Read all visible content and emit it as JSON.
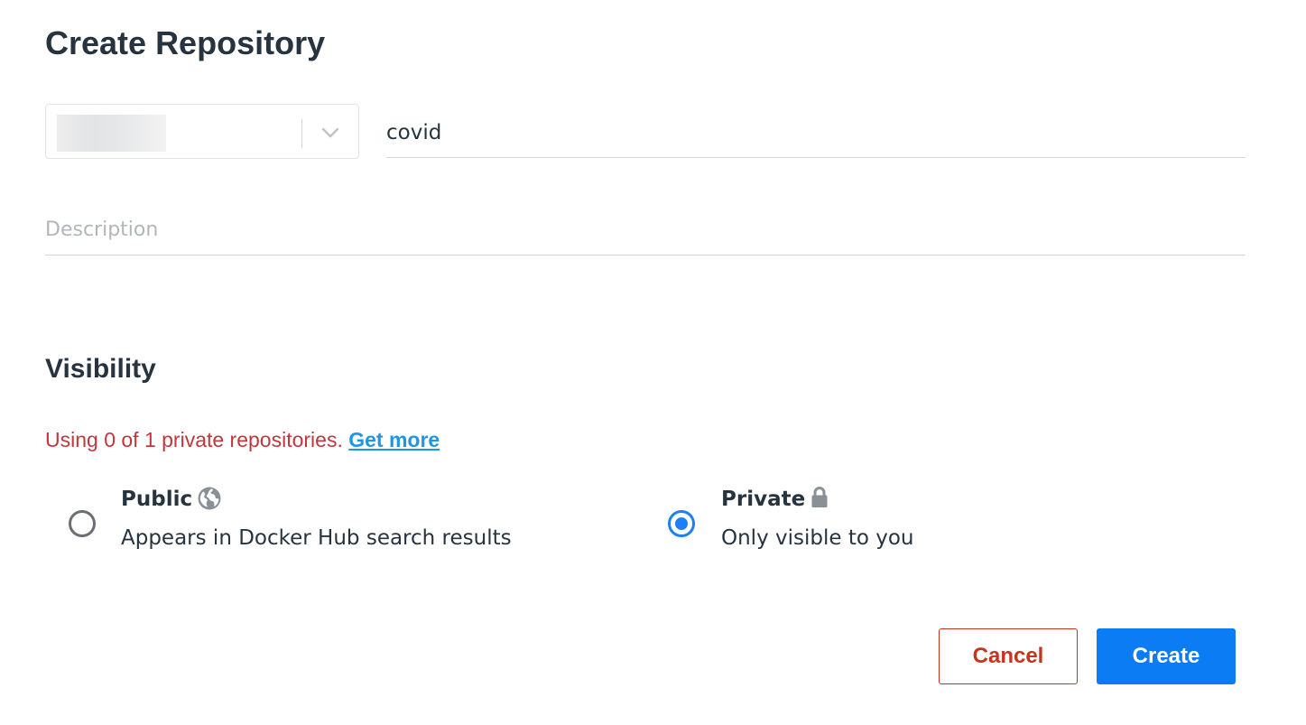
{
  "page": {
    "title": "Create Repository"
  },
  "form": {
    "namespace": {
      "value": "",
      "chevron_icon": "chevron-down-icon"
    },
    "name": {
      "value": "covid"
    },
    "description": {
      "placeholder": "Description",
      "value": ""
    }
  },
  "visibility": {
    "title": "Visibility",
    "usage_text": "Using 0 of 1 private repositories.",
    "get_more_link": "Get more",
    "options": [
      {
        "label": "Public",
        "description": "Appears in Docker Hub search results",
        "icon": "globe-icon",
        "selected": false
      },
      {
        "label": "Private",
        "description": "Only visible to you",
        "icon": "lock-icon",
        "selected": true
      }
    ]
  },
  "actions": {
    "cancel_label": "Cancel",
    "create_label": "Create"
  },
  "colors": {
    "primary": "#0c7cf5",
    "danger": "#c7341e",
    "warning_text": "#c0373c",
    "link": "#1f95e8",
    "radio_selected": "#1d7ff9"
  }
}
